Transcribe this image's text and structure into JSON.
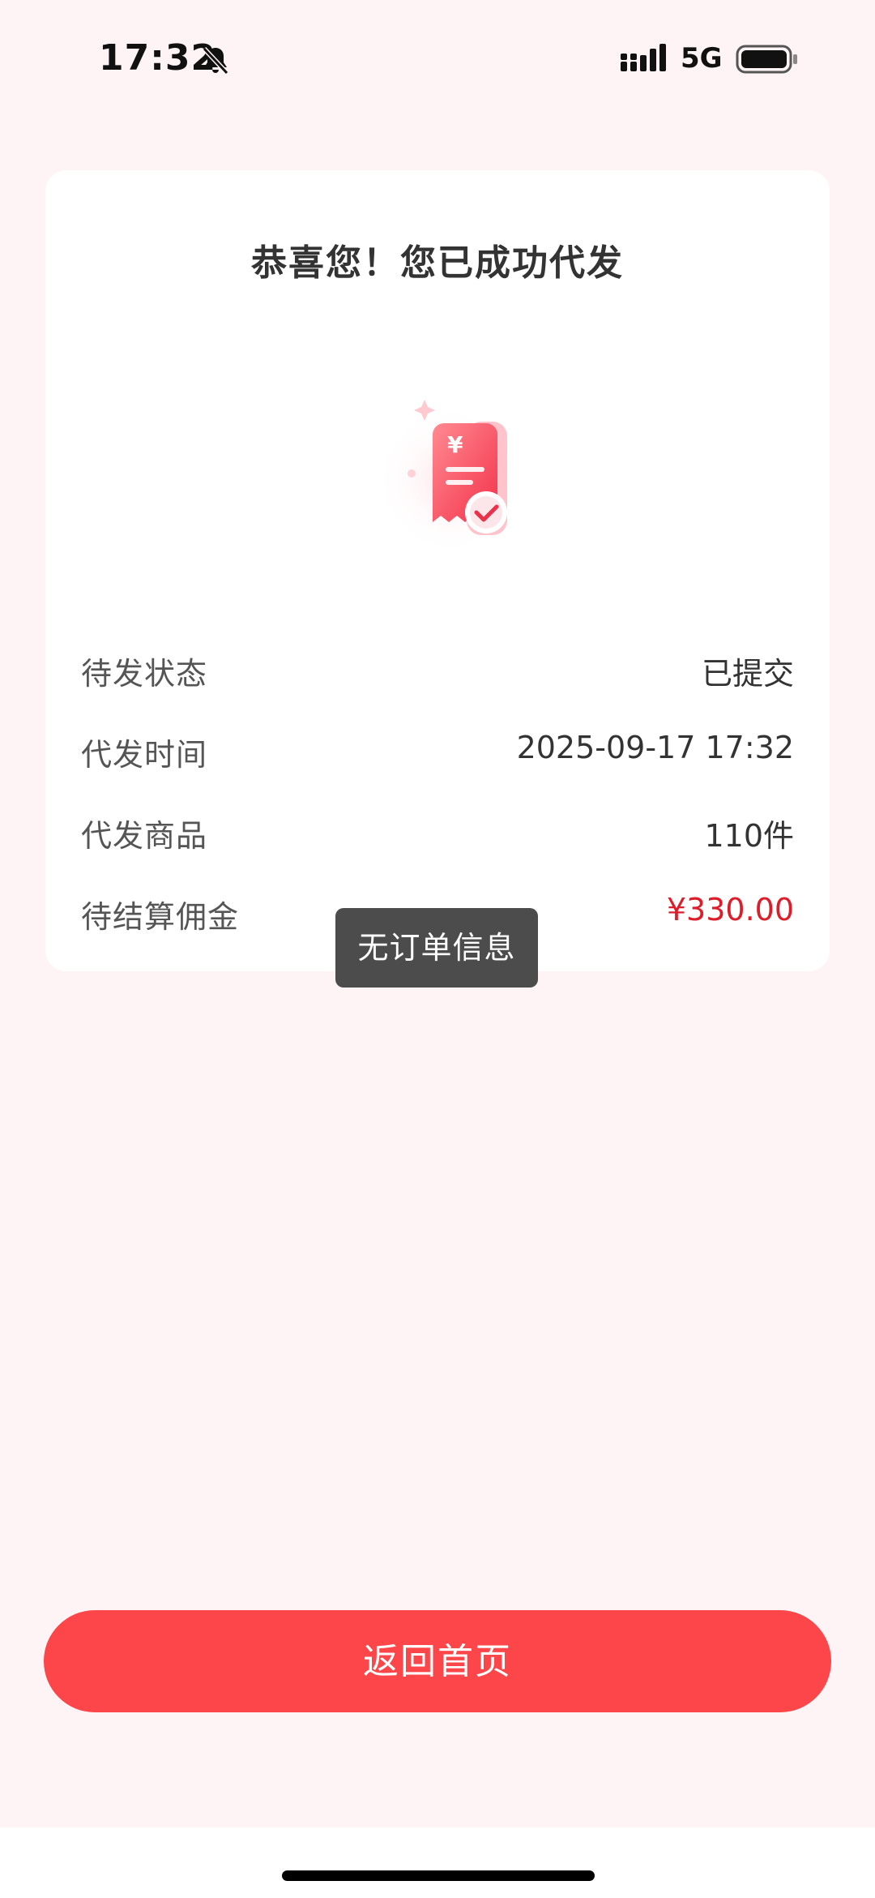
{
  "status_bar": {
    "time": "17:32",
    "network": "5G",
    "icons": [
      "bell-slash-icon",
      "signal-bars-icon",
      "battery-icon"
    ]
  },
  "card": {
    "title": "恭喜您！您已成功代发",
    "illustration": "receipt-check-icon",
    "rows": [
      {
        "label": "待发状态",
        "value": "已提交"
      },
      {
        "label": "代发时间",
        "value": "2025-09-17 17:32"
      },
      {
        "label": "代发商品",
        "value": "110件"
      },
      {
        "label": "待结算佣金",
        "value": "¥330.00"
      }
    ]
  },
  "toast": {
    "message": "无订单信息"
  },
  "actions": {
    "home_button_label": "返回首页"
  },
  "colors": {
    "background": "#fff4f5",
    "accent": "#fd4649",
    "price": "#dd1d2a",
    "toast_bg": "#4c4c4c"
  }
}
